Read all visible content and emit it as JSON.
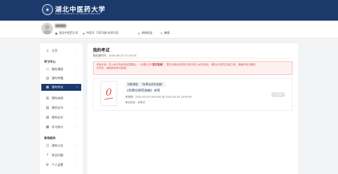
{
  "header": {
    "logo_glyph": "✦",
    "university_name": "湖北中医药大学",
    "university_name_en": "HUBEI UNIVERSITY OF CHINESE MEDICINE"
  },
  "profile": {
    "name_suffix": "",
    "school": "湖北中医药大学",
    "major": "中医学（2023级-秋季1班）",
    "link_1": "调取权益",
    "link_2": "编辑"
  },
  "sidebar": {
    "home": "主页",
    "section_learning": "学习中心",
    "items": [
      "我的课程",
      "我的考籍",
      "我的考试",
      "我的成绩",
      "我的证书",
      "我的论文",
      "学习统计"
    ],
    "section_other": "其他相关",
    "other_items": [
      "通知公告",
      "常见问题",
      "个人设置"
    ]
  },
  "main": {
    "title": "我的考试",
    "server_time": "服务器时间：2024-06-24 11:23:10",
    "notice_line1_pre": "考前必读：进入考试系统完成答题后，一定要点击",
    "notice_bold": "“提交答卷”",
    "notice_line1_post": "，提交试卷后您将无法再次进入考试系统。请务必在提交答卷之前，确保所有试题均",
    "notice_line2": "已作答，避免影响考试成绩。",
    "card": {
      "score_mark": "0",
      "course": "所属课程：《伤寒论研究进展》",
      "exam_name": "《伤寒论研究进展》试卷",
      "period": "有效期：2024-03-03 00:00:00 至 2024-03-03 23:59:59",
      "status": "考试状态：未考试",
      "button": "已过期"
    }
  },
  "colors": {
    "primary": "#1b3a6b",
    "notice_bg": "#fdf0ef",
    "notice_text": "#d9534f",
    "score_red": "#e74c3c"
  }
}
